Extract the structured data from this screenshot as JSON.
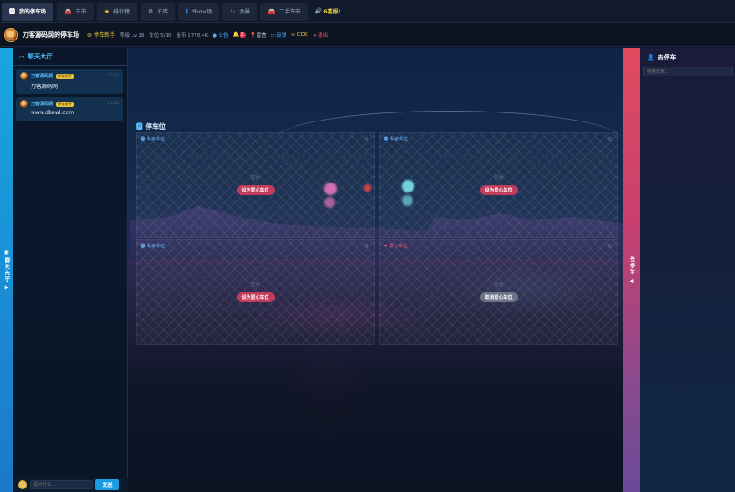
{
  "nav": {
    "tabs": [
      {
        "label": "我的停车场",
        "icon": "parking-icon",
        "active": true
      },
      {
        "label": "车市",
        "icon": "car-icon",
        "active": false
      },
      {
        "label": "排行榜",
        "icon": "star-icon",
        "active": false
      },
      {
        "label": "车库",
        "icon": "gear-icon",
        "active": false
      },
      {
        "label": "Show场",
        "icon": "info-icon",
        "active": false
      },
      {
        "label": "场景",
        "icon": "refresh-icon",
        "active": false
      },
      {
        "label": "二手车市",
        "icon": "car-icon",
        "active": false
      }
    ],
    "special": "6喜报!"
  },
  "info": {
    "lot_title": "刀客源码网的停车场",
    "level_badge": "停车新手",
    "grade": "等级 Lv.18",
    "spots": "车位 5/10",
    "coins": "金币 1778.4K",
    "announcement": "公告",
    "bell_count": "2",
    "message": "留言",
    "feedback": "反馈",
    "cdk": "CDK",
    "logout": "退出"
  },
  "chat": {
    "vertical_label": "聊天大厅",
    "title": "聊天大厅",
    "messages": [
      {
        "name": "刀客源码网",
        "tag": "停车新手",
        "time": "13:52",
        "text": "刀客源码网"
      },
      {
        "name": "刀客源码网",
        "tag": "停车新手",
        "time": "13:52",
        "text": "www.dkewl.com"
      }
    ],
    "input_placeholder": "说点什么...",
    "send_label": "发送"
  },
  "parking": {
    "title": "停车位",
    "spots": [
      {
        "label": "私家车位",
        "status": "空闲",
        "button": "设为爱心车位",
        "type": "normal"
      },
      {
        "label": "私家车位",
        "status": "空闲",
        "button": "设为爱心车位",
        "type": "normal"
      },
      {
        "label": "私家车位",
        "status": "空闲",
        "button": "设为爱心车位",
        "type": "normal"
      },
      {
        "label": "爱心车位",
        "status": "空闲",
        "button": "取消爱心车位",
        "type": "love"
      }
    ]
  },
  "right": {
    "vertical_label": "去停车",
    "title": "去停车",
    "search_placeholder": "搜索玩家..."
  },
  "colors": {
    "accent_blue": "#1c9be0",
    "accent_red": "#c23c5c",
    "gold": "#e6c23a"
  }
}
